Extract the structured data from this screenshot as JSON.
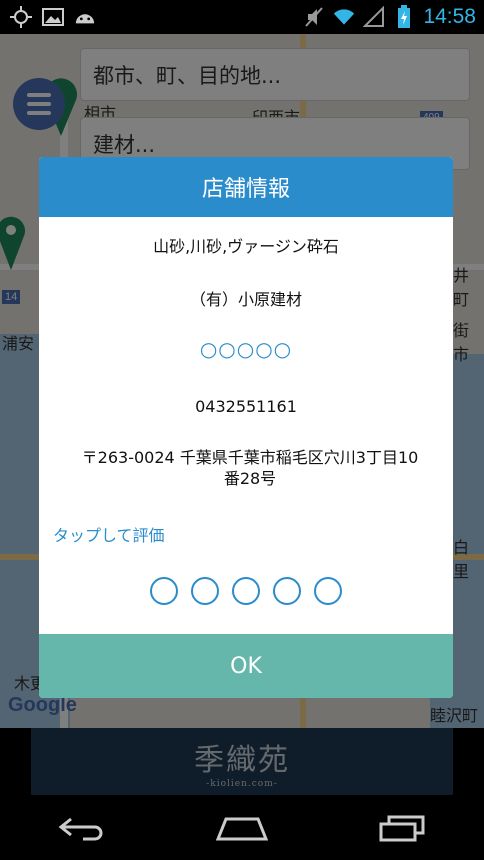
{
  "status_bar": {
    "time": "14:58"
  },
  "search": {
    "location_placeholder": "都市、町、目的地...",
    "category_value": "建材..."
  },
  "map": {
    "labels": [
      "相市",
      "印西市",
      "浦安",
      "木更",
      "井町",
      "街市",
      "白里",
      "睦沢町"
    ],
    "route_badge": "14",
    "route_badge2": "409",
    "google": "Google"
  },
  "dialog": {
    "title": "店舗情報",
    "materials": "山砂,川砂,ヴァージン砕石",
    "company": "（有）小原建材",
    "rating_display": "○○○○○",
    "phone": "0432551161",
    "address": "〒263-0024 千葉県千葉市稲毛区穴川3丁目10番28号",
    "tap_to_rate": "タップして評価",
    "ok": "OK"
  },
  "banner": {
    "logo": "季織苑",
    "sub": "-kiolien.com-"
  }
}
